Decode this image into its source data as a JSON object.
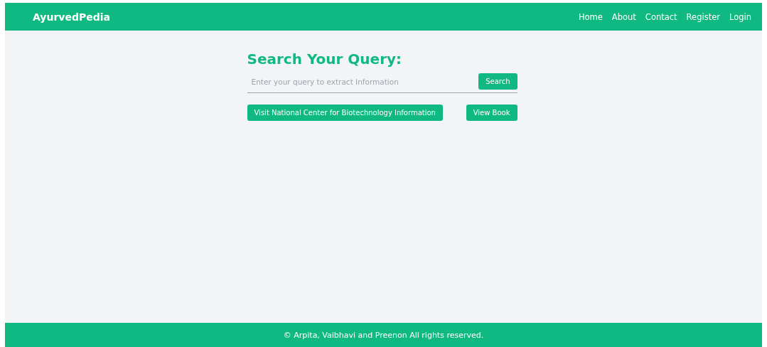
{
  "header": {
    "brand": "AyurvedPedia",
    "nav": [
      {
        "label": "Home"
      },
      {
        "label": "About"
      },
      {
        "label": "Contact"
      },
      {
        "label": "Register"
      },
      {
        "label": "Login"
      }
    ]
  },
  "search": {
    "heading": "Search Your Query:",
    "placeholder": "Enter your query to extract Information",
    "button": "Search"
  },
  "links": [
    {
      "label": "Visit National Center for Biotechnology Information"
    },
    {
      "label": "View Book"
    }
  ],
  "footer": {
    "text": "© Arpita, Vaibhavi and Preenon All rights reserved."
  }
}
